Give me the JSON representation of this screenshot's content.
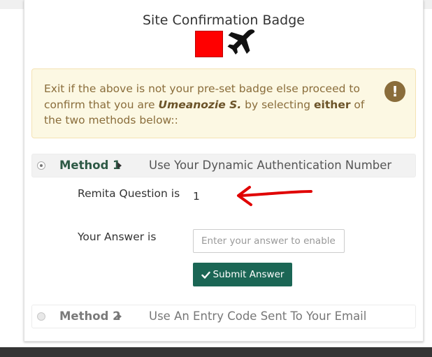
{
  "badge": {
    "title": "Site Confirmation Badge",
    "color": "#ff0000",
    "icon": "airplane-icon"
  },
  "alert": {
    "text_before": "Exit if the above is not your pre-set badge else proceed to confirm that you are ",
    "name": "Umeanozie S.",
    "text_middle": " by selecting ",
    "emphasis": "either",
    "text_after": " of the two methods below::",
    "icon": "exclamation-icon"
  },
  "methods": [
    {
      "label": "Method 1",
      "description": "Use Your Dynamic Authentication Number",
      "selected": true
    },
    {
      "label": "Method 2",
      "description": "Use An Entry Code Sent To Your Email",
      "selected": false
    }
  ],
  "form": {
    "question_label": "Remita Question is",
    "question_value": "1",
    "answer_label": "Your Answer is",
    "answer_placeholder": "Enter your answer to enable your login",
    "answer_value": "",
    "submit_label": "Submit Answer"
  },
  "colors": {
    "accent": "#1b6655",
    "alert_bg": "#fcf8e3",
    "alert_text": "#8a6d3b",
    "annotation_arrow": "#e00000"
  }
}
